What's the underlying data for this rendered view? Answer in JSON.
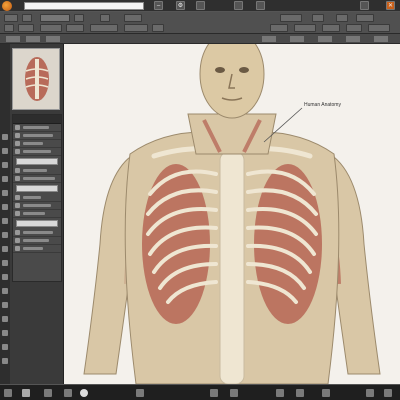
{
  "window": {
    "app_icon": "app-logo-icon",
    "title": "",
    "path": ""
  },
  "viewport": {
    "callout_text": "Human Anatomy"
  },
  "panel": {
    "header": "",
    "fields": [
      "",
      "",
      ""
    ]
  },
  "statusbar": {
    "text": ""
  },
  "colors": {
    "background": "#3f3f3f",
    "viewport": "#f4f1ec",
    "skin": "#d9c7a6",
    "muscle": "#b86b5a",
    "bone": "#efe6d2"
  }
}
